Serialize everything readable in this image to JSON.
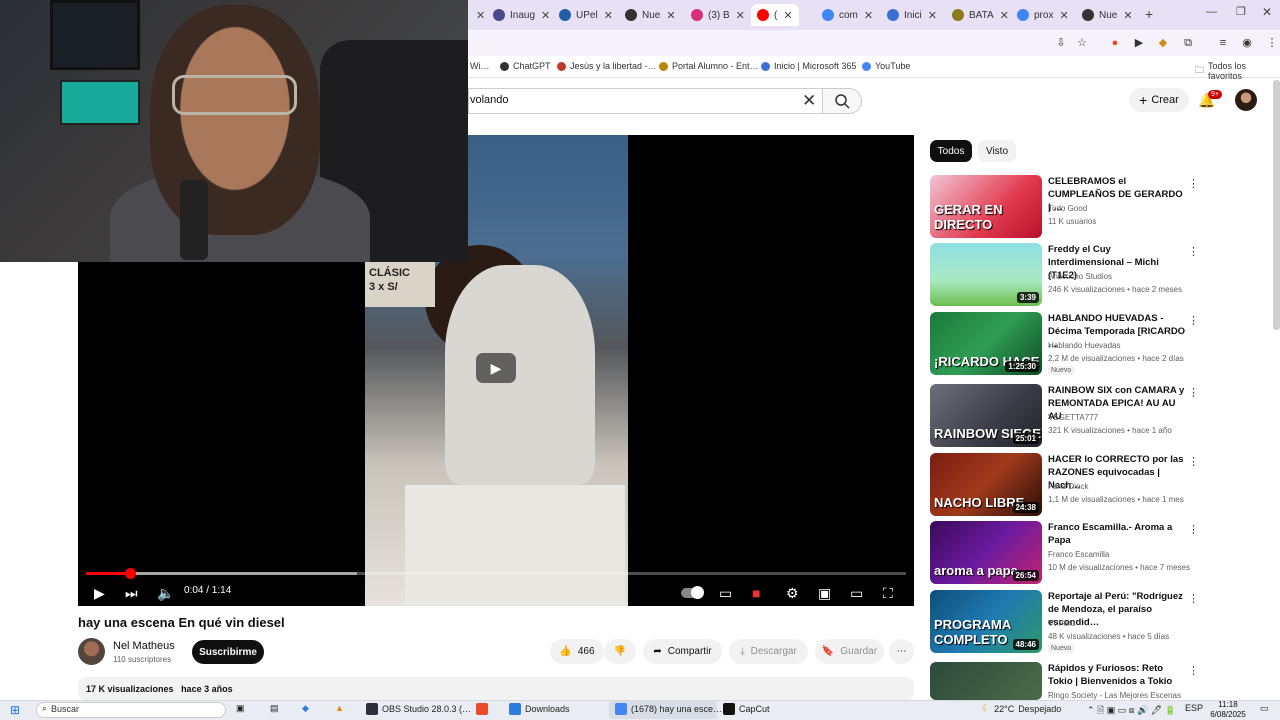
{
  "browser": {
    "tabs": [
      {
        "label": "Inaug",
        "color": "#4a4a8a"
      },
      {
        "label": "UPel",
        "color": "#1f5fa8"
      },
      {
        "label": "Nue",
        "color": "#333"
      },
      {
        "label": "(3) B",
        "color": "#d6307a"
      },
      {
        "label": "(",
        "color": "#ff0000"
      },
      {
        "label": "com",
        "color": "#4285f4"
      },
      {
        "label": "Inici",
        "color": "#3b6fd8"
      },
      {
        "label": "BATA",
        "color": "#8a7a1a"
      },
      {
        "label": "prox",
        "color": "#4285f4"
      },
      {
        "label": "Nue",
        "color": "#333"
      }
    ],
    "bookmarks": [
      {
        "label": "Wi…",
        "color": "#888"
      },
      {
        "label": "ChatGPT",
        "color": "#333"
      },
      {
        "label": "Jesús y la libertad -…",
        "color": "#c0392b"
      },
      {
        "label": "Portal Alumno - Ent…",
        "color": "#b8860b"
      },
      {
        "label": "Inicio | Microsoft 365",
        "color": "#3b6fd8"
      },
      {
        "label": "YouTube",
        "color": "#4285f4"
      }
    ],
    "bookmarks_folder": "Todos los favoritos"
  },
  "header": {
    "search_value": "volando",
    "create_label": "Crear",
    "notif_count": "9+"
  },
  "player": {
    "sign_text": "CLÁSIC\n3 x S/",
    "progress": 0.054,
    "buffered": 0.33,
    "time": "0:04 / 1:14"
  },
  "video": {
    "title": "hay una escena En qué vin diesel",
    "channel": "Nel Matheus",
    "subscribers": "110 suscriptores",
    "subscribe_label": "Suscribirme",
    "likes": "466",
    "share_label": "Compartir",
    "download_label": "Descargar",
    "save_label": "Guardar",
    "views": "17 K visualizaciones",
    "age": "hace 3 años"
  },
  "sidebar": {
    "chips": [
      "Todos",
      "Visto"
    ],
    "items": [
      {
        "title": "CELEBRAMOS  el CUMPLEAÑOS DE GERARDO | …",
        "channel": "Todo Good",
        "views": "11 K usuarios",
        "duration": "",
        "badge": "",
        "thumb_text": "GERAR EN DIRECTO",
        "thumb_bg": "linear-gradient(135deg,#f1c6d6,#e23b4f 60%,#b8102a)"
      },
      {
        "title": "Freddy el Cuy Interdimensional – Michi (T1E2)",
        "channel": "Anticucho Studios",
        "views": "246 K visualizaciones • hace 2 meses",
        "duration": "3:39",
        "badge": "",
        "thumb_text": "",
        "thumb_bg": "linear-gradient(180deg,#8fe0e6 0%,#a9e8c0 60%,#6bbf4e 100%)"
      },
      {
        "title": "HABLANDO HUEVADAS - Décima Temporada [RICARDO …",
        "channel": "Hablando Huevadas",
        "views": "2,2 M de visualizaciones • hace 2 días",
        "duration": "1:25:30",
        "badge": "Nuevo",
        "thumb_text": "¡RICARDO HACE",
        "thumb_bg": "linear-gradient(135deg,#1b7a3c,#2f9e55 50%,#0f4d25)"
      },
      {
        "title": "RAINBOW SIX con CAMARA y REMONTADA EPICA! AU AU AU",
        "channel": "VEGETTA777",
        "views": "321 K visualizaciones • hace 1 año",
        "duration": "25:01",
        "badge": "",
        "thumb_text": "RAINBOW SIEGE",
        "thumb_bg": "linear-gradient(135deg,#6f6f7a,#3c3c46 60%,#22222a)"
      },
      {
        "title": "HACER lo CORRECTO por las RAZONES equivocadas | Nach…",
        "channel": "Farid Dieck",
        "views": "1,1 M de visualizaciones • hace 1 mes",
        "duration": "24:38",
        "badge": "",
        "thumb_text": "NACHO LIBRE",
        "thumb_bg": "linear-gradient(135deg,#7a1d12,#a03a1b 50%,#2a0d08)"
      },
      {
        "title": "Franco Escamilla.- Aroma a Papa",
        "channel": "Franco Escamilla",
        "views": "10 M de visualizaciones • hace 7 meses",
        "duration": "26:54",
        "badge": "",
        "thumb_text": "aroma a papa",
        "thumb_bg": "linear-gradient(135deg,#3a0a5a,#6b1aa0 50%,#c2246f)"
      },
      {
        "title": "Reportaje al Perú: \"Rodríguez de Mendoza, el paraíso escondid…",
        "channel": "TVPerú",
        "views": "48 K visualizaciones • hace 5 días",
        "duration": "48:46",
        "badge": "Nuevo",
        "thumb_text": "PROGRAMA COMPLETO",
        "thumb_bg": "linear-gradient(135deg,#0e4e7a,#1f7ab0 50%,#2e9a6a)"
      },
      {
        "title": "Rápidos y Furiosos: Reto Tokio | Bienvenidos a Tokio",
        "channel": "Ringo Society - Las Mejores Escenas De…",
        "views": "",
        "duration": "",
        "badge": "",
        "thumb_text": "",
        "thumb_bg": "linear-gradient(135deg,#2b4a3a,#4c6a4a)"
      }
    ]
  },
  "taskbar": {
    "search_placeholder": "Buscar",
    "apps": [
      {
        "label": "OBS Studio 28.0.3 (…",
        "color": "#302e3a"
      },
      {
        "label": "",
        "color": "#e84c2b"
      },
      {
        "label": "Downloads",
        "color": "#2b7de0"
      },
      {
        "label": "(1678) hay una esce…",
        "color": "#4285f4"
      },
      {
        "label": "CapCut",
        "color": "#111"
      }
    ],
    "weather_temp": "22°C",
    "weather_desc": "Despejado",
    "lang": "ESP",
    "clock_time": "11:18",
    "clock_date": "6/08/2025"
  }
}
